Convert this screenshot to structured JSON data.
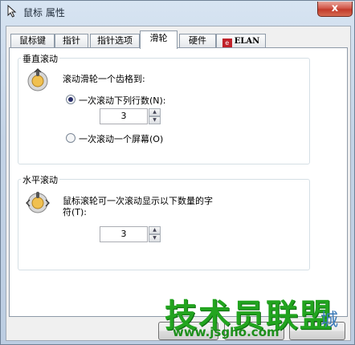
{
  "window": {
    "title": "鼠标 属性",
    "close_glyph": "x"
  },
  "tabs": [
    "鼠标键",
    "指针",
    "指针选项",
    "滑轮",
    "硬件",
    "ELAN"
  ],
  "active_tab": "滑轮",
  "vertical": {
    "legend": "垂直滚动",
    "prompt": "滚动滑轮一个齿格到:",
    "option_lines": "一次滚动下列行数(N):",
    "lines_value": "3",
    "option_screen": "一次滚动一个屏幕(O)"
  },
  "horizontal": {
    "legend": "水平滚动",
    "prompt_line1": "鼠标滚轮可一次滚动显示以下数量的字",
    "prompt_line2": "符(T):",
    "chars_value": "3"
  },
  "watermark": {
    "big": "技术员联盟",
    "url": "www.jsgho.com",
    "cheng": "城"
  },
  "icons": {
    "app": "mouse-pointer-icon",
    "wheel": "scroll-wheel-icon"
  }
}
